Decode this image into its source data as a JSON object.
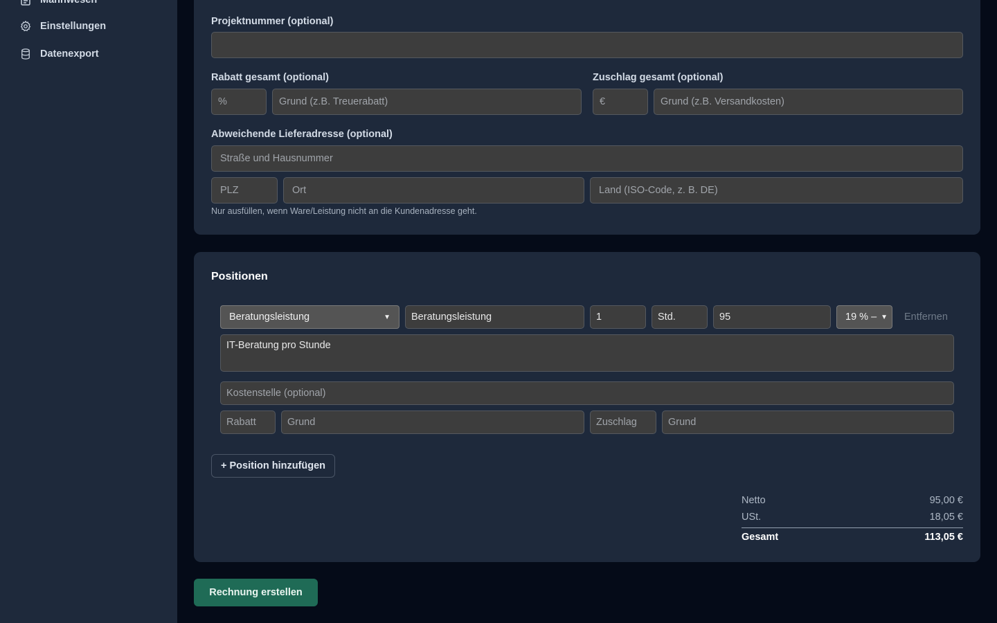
{
  "sidebar": {
    "items": [
      {
        "label": "Mahnwesen",
        "icon": "document-icon"
      },
      {
        "label": "Einstellungen",
        "icon": "gear-icon"
      },
      {
        "label": "Datenexport",
        "icon": "database-icon"
      }
    ]
  },
  "details": {
    "project_label": "Projektnummer (optional)",
    "project_value": "",
    "discount_label": "Rabatt gesamt (optional)",
    "discount_unit": "%",
    "discount_reason_placeholder": "Grund (z.B. Treuerabatt)",
    "surcharge_label": "Zuschlag gesamt (optional)",
    "surcharge_unit": "€",
    "surcharge_reason_placeholder": "Grund (z.B. Versandkosten)",
    "delivery_label": "Abweichende Lieferadresse (optional)",
    "street_placeholder": "Straße und Hausnummer",
    "zip_placeholder": "PLZ",
    "city_placeholder": "Ort",
    "country_placeholder": "Land (ISO-Code, z. B. DE)",
    "delivery_hint": "Nur ausfüllen, wenn Ware/Leistung nicht an die Kundenadresse geht."
  },
  "positions": {
    "title": "Positionen",
    "item": {
      "product_select": "Beratungsleistung",
      "name": "Beratungsleistung",
      "quantity": "1",
      "unit": "Std.",
      "price": "95",
      "tax_select": "19 % –",
      "remove_label": "Entfernen",
      "description": "IT-Beratung pro Stunde",
      "cost_center_placeholder": "Kostenstelle (optional)",
      "discount_placeholder": "Rabatt",
      "discount_reason_placeholder": "Grund",
      "surcharge_placeholder": "Zuschlag",
      "surcharge_reason_placeholder": "Grund"
    },
    "add_button": "+ Position hinzufügen",
    "summary": {
      "net_label": "Netto",
      "net_value": "95,00 €",
      "tax_label": "USt.",
      "tax_value": "18,05 €",
      "total_label": "Gesamt",
      "total_value": "113,05 €"
    }
  },
  "submit_button": "Rechnung erstellen"
}
